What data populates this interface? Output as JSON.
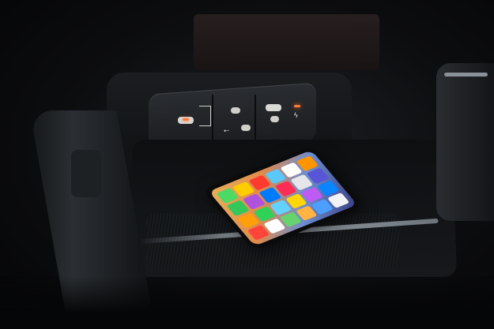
{
  "scene": {
    "colors": {
      "background": "#050607",
      "port_panel": "#1a1c1f",
      "led_accent": "#ff7a3a",
      "port_metal": "#d9d9d6",
      "tray_edge": "#9aa3ab"
    },
    "icons": {
      "usb": "usb-trident-icon",
      "wireless_charging": "wireless-charging-icon",
      "lightning": "lightning-icon"
    },
    "app_colors": [
      "#4cd964",
      "#ffcc00",
      "#ff3b30",
      "#5ac8fa",
      "#ffffff",
      "#ff9500",
      "#34c759",
      "#af52de",
      "#007aff",
      "#ff2d55",
      "#e5e5ea",
      "#5856d6",
      "#ff9f0a",
      "#30d158",
      "#64d2ff",
      "#ffd60a",
      "#bf5af2",
      "#0a84ff",
      "#ff453a",
      "#ffffff",
      "#66d36e",
      "#ffb340",
      "#4d9fff",
      "#f2f2f7"
    ]
  }
}
